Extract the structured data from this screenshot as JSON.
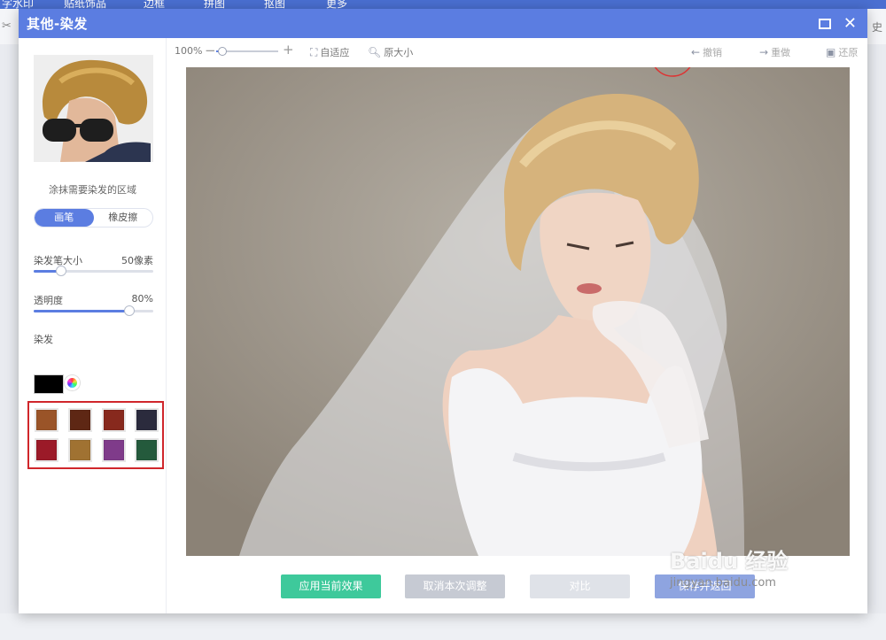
{
  "background": {
    "menu_items": [
      "字水印",
      "贴纸饰品",
      "边框",
      "拼图",
      "抠图",
      "更多"
    ],
    "right_fragment": "史"
  },
  "dialog": {
    "title": "其他-染发"
  },
  "sidebar": {
    "hint": "涂抹需要染发的区域",
    "tool_brush": "画笔",
    "tool_eraser": "橡皮擦",
    "brush_size_label": "染发笔大小",
    "brush_size_value": "50像素",
    "brush_size_level": 0.23,
    "opacity_label": "透明度",
    "opacity_value": "80%",
    "opacity_level": 0.8,
    "dye_label": "染发",
    "current_color": "#000000",
    "swatches": [
      "#9a5428",
      "#5e2714",
      "#87291d",
      "#2b2b3d",
      "#9b1a28",
      "#a07232",
      "#7f3b8a",
      "#245a3c"
    ]
  },
  "toolbar": {
    "zoom_pct": "100%",
    "zoom_level": 0.1,
    "fit_label": "自适应",
    "original_label": "原大小",
    "undo_label": "撤销",
    "redo_label": "重做",
    "restore_label": "还原"
  },
  "footer": {
    "apply": "应用当前效果",
    "cancel": "取消本次调整",
    "compare": "对比",
    "save": "保存并返回"
  },
  "watermark": {
    "main": "Baidu 经验",
    "sub": "jingyan.baidu.com"
  }
}
